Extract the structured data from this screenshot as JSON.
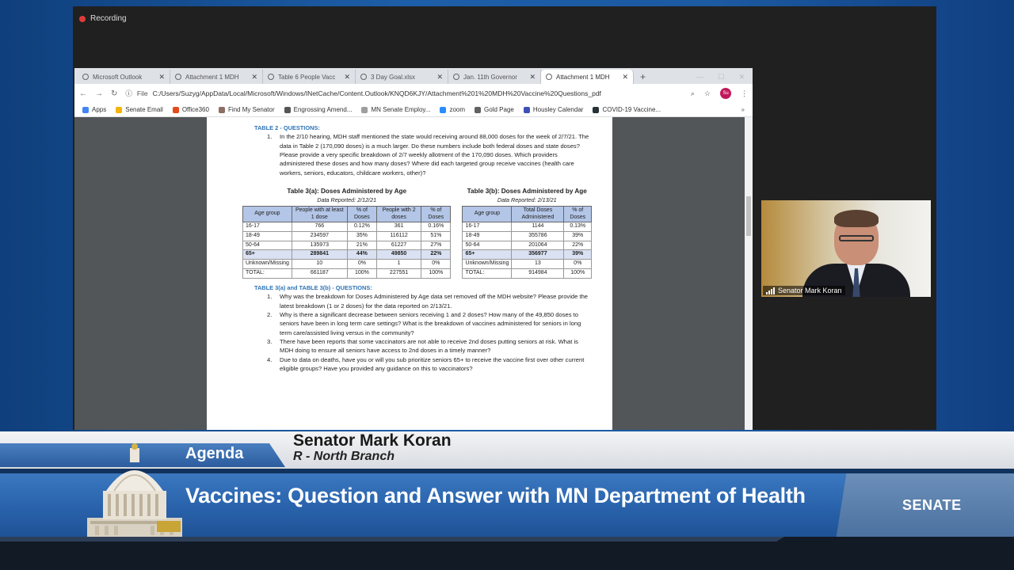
{
  "recording": {
    "label": "Recording"
  },
  "browser": {
    "tabs": [
      {
        "label": "Microsoft Outlook",
        "active": false
      },
      {
        "label": "Attachment 1 MDH",
        "active": false
      },
      {
        "label": "Table 6 People Vacc",
        "active": false
      },
      {
        "label": "3 Day Goal.xlsx",
        "active": false
      },
      {
        "label": "Jan. 11th Governor",
        "active": false
      },
      {
        "label": "Attachment 1 MDH",
        "active": true
      }
    ],
    "scheme": "File",
    "url": "C:/Users/Suzyg/AppData/Local/Microsoft/Windows/INetCache/Content.Outlook/KNQD6KJY/Attachment%201%20MDH%20Vaccine%20Questions_pdf",
    "avatar": "Su",
    "bookmarks": [
      {
        "label": "Apps",
        "color": "#4285f4"
      },
      {
        "label": "Senate Email",
        "color": "#f4b400"
      },
      {
        "label": "Office360",
        "color": "#e64a19"
      },
      {
        "label": "Find My Senator",
        "color": "#8d6e63"
      },
      {
        "label": "Engrossing Amend...",
        "color": "#555555"
      },
      {
        "label": "MN Senate Employ...",
        "color": "#9e9e9e"
      },
      {
        "label": "zoom",
        "color": "#2d8cff"
      },
      {
        "label": "Gold Page",
        "color": "#616161"
      },
      {
        "label": "Housley Calendar",
        "color": "#3f51b5"
      },
      {
        "label": "COVID-19 Vaccine...",
        "color": "#263238"
      }
    ]
  },
  "pdf": {
    "table2_heading": "TABLE 2 - QUESTIONS:",
    "table2_questions": [
      {
        "n": "1.",
        "text": "In the 2/10 hearing, MDH staff mentioned the state would receiving around 88,000 doses for the week of 2/7/21. The data in Table 2 (170,090 doses) is a much larger. Do these numbers include both federal doses and state doses? Please provide a very specific breakdown of 2/7 weekly allotment of the 170,090 doses. Which providers administered these doses and how many doses? Where did each targeted group receive vaccines (health care workers, seniors, educators, childcare workers, other)?"
      }
    ],
    "table3a": {
      "title": "Table 3(a): Doses Administered by Age",
      "subtitle": "Data Reported: 2/12/21",
      "headers": [
        "Age group",
        "People with at least 1 dose",
        "% of Doses",
        "People with 2 doses",
        "% of Doses"
      ],
      "rows": [
        {
          "cells": [
            "16-17",
            "766",
            "0.12%",
            "361",
            "0.16%"
          ],
          "highlight": false
        },
        {
          "cells": [
            "18-49",
            "234597",
            "35%",
            "116112",
            "51%"
          ],
          "highlight": false
        },
        {
          "cells": [
            "50-64",
            "135973",
            "21%",
            "61227",
            "27%"
          ],
          "highlight": false
        },
        {
          "cells": [
            "65+",
            "289841",
            "44%",
            "49850",
            "22%"
          ],
          "highlight": true
        },
        {
          "cells": [
            "Unknown/Missing",
            "10",
            "0%",
            "1",
            "0%"
          ],
          "highlight": false
        },
        {
          "cells": [
            "TOTAL:",
            "661187",
            "100%",
            "227551",
            "100%"
          ],
          "highlight": false
        }
      ]
    },
    "table3b": {
      "title": "Table 3(b): Doses Administered by Age",
      "subtitle": "Data Reported: 2/13/21",
      "headers": [
        "Age group",
        "Total Doses Administered",
        "% of Doses"
      ],
      "rows": [
        {
          "cells": [
            "16-17",
            "1144",
            "0.13%"
          ],
          "highlight": false
        },
        {
          "cells": [
            "18-49",
            "355786",
            "39%"
          ],
          "highlight": false
        },
        {
          "cells": [
            "50-64",
            "201064",
            "22%"
          ],
          "highlight": false
        },
        {
          "cells": [
            "65+",
            "356977",
            "39%"
          ],
          "highlight": true
        },
        {
          "cells": [
            "Unknown/Missing",
            "13",
            "0%"
          ],
          "highlight": false
        },
        {
          "cells": [
            "TOTAL:",
            "914984",
            "100%"
          ],
          "highlight": false
        }
      ]
    },
    "table3_heading": "TABLE 3(a) and TABLE 3(b) - QUESTIONS:",
    "table3_questions": [
      {
        "n": "1.",
        "text": "Why was the breakdown for Doses Administered by Age data set removed off the MDH website? Please provide the latest breakdown (1 or 2 doses) for the data reported on 2/13/21."
      },
      {
        "n": "2.",
        "text": "Why is there a significant decrease between seniors receiving 1 and 2 doses? How many of the 49,850 doses to seniors have been in long term care settings? What is the breakdown of vaccines administered for seniors in long term care/assisted living versus in the community?"
      },
      {
        "n": "3.",
        "text": "There have been reports that some vaccinators are not able to receive 2nd doses putting seniors at risk. What is MDH doing to ensure all seniors have access to 2nd doses in a timely manner?"
      },
      {
        "n": "4.",
        "text": "Due to data on deaths, have you or will you sub prioritize seniors 65+ to receive the vaccine first over other current eligible groups? Have you provided any guidance on this to vaccinators?"
      }
    ]
  },
  "presenter": {
    "name": "Senator Mark Koran"
  },
  "lower_third": {
    "agenda_label": "Agenda",
    "speaker_name": "Senator Mark Koran",
    "speaker_district": "R - North Branch",
    "title": "Vaccines: Question and Answer with MN Department of Health",
    "brand": "SENATE"
  },
  "colors": {
    "brand_blue": "#2a64ad",
    "table_header": "#b4c6e7",
    "heading_blue": "#2e74b5"
  }
}
